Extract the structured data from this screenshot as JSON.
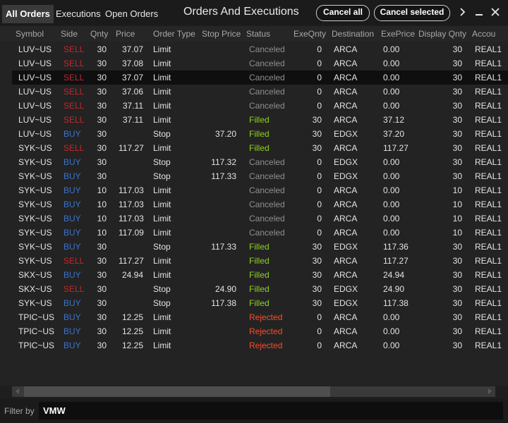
{
  "tabs": [
    {
      "label": "All Orders",
      "active": true
    },
    {
      "label": "Executions",
      "active": false
    },
    {
      "label": "Open Orders",
      "active": false
    }
  ],
  "window": {
    "title": "Orders And Executions"
  },
  "actions": {
    "cancel_all": "Cancel all",
    "cancel_selected": "Cancel selected"
  },
  "icons": {
    "more": "chevron-right-icon",
    "minimize": "minimize-icon",
    "close": "close-icon"
  },
  "colors": {
    "sell": "#c1272d",
    "buy": "#3b73c8",
    "filled": "#8ed21f",
    "rejected": "#ff4a2a",
    "canceled": "#8f8f8f"
  },
  "columns": [
    "Symbol",
    "Side",
    "Qnty",
    "Price",
    "Order Type",
    "Stop Price",
    "Status",
    "ExeQnty",
    "Destination",
    "ExePrice",
    "Display Qnty",
    "Accou"
  ],
  "selected_row": 2,
  "rows": [
    {
      "symbol": "LUV~US",
      "side": "SELL",
      "qty": "30",
      "price": "37.07",
      "type": "Limit",
      "stop": "",
      "status": "Canceled",
      "exe_qty": "0",
      "dest": "ARCA",
      "exe_price": "0.00",
      "display_qty": "30",
      "account": "REAL1"
    },
    {
      "symbol": "LUV~US",
      "side": "SELL",
      "qty": "30",
      "price": "37.08",
      "type": "Limit",
      "stop": "",
      "status": "Canceled",
      "exe_qty": "0",
      "dest": "ARCA",
      "exe_price": "0.00",
      "display_qty": "30",
      "account": "REAL1"
    },
    {
      "symbol": "LUV~US",
      "side": "SELL",
      "qty": "30",
      "price": "37.07",
      "type": "Limit",
      "stop": "",
      "status": "Canceled",
      "exe_qty": "0",
      "dest": "ARCA",
      "exe_price": "0.00",
      "display_qty": "30",
      "account": "REAL1"
    },
    {
      "symbol": "LUV~US",
      "side": "SELL",
      "qty": "30",
      "price": "37.06",
      "type": "Limit",
      "stop": "",
      "status": "Canceled",
      "exe_qty": "0",
      "dest": "ARCA",
      "exe_price": "0.00",
      "display_qty": "30",
      "account": "REAL1"
    },
    {
      "symbol": "LUV~US",
      "side": "SELL",
      "qty": "30",
      "price": "37.11",
      "type": "Limit",
      "stop": "",
      "status": "Canceled",
      "exe_qty": "0",
      "dest": "ARCA",
      "exe_price": "0.00",
      "display_qty": "30",
      "account": "REAL1"
    },
    {
      "symbol": "LUV~US",
      "side": "SELL",
      "qty": "30",
      "price": "37.11",
      "type": "Limit",
      "stop": "",
      "status": "Filled",
      "exe_qty": "30",
      "dest": "ARCA",
      "exe_price": "37.12",
      "display_qty": "30",
      "account": "REAL1"
    },
    {
      "symbol": "LUV~US",
      "side": "BUY",
      "qty": "30",
      "price": "",
      "type": "Stop",
      "stop": "37.20",
      "status": "Filled",
      "exe_qty": "30",
      "dest": "EDGX",
      "exe_price": "37.20",
      "display_qty": "30",
      "account": "REAL1"
    },
    {
      "symbol": "SYK~US",
      "side": "SELL",
      "qty": "30",
      "price": "117.27",
      "type": "Limit",
      "stop": "",
      "status": "Filled",
      "exe_qty": "30",
      "dest": "ARCA",
      "exe_price": "117.27",
      "display_qty": "30",
      "account": "REAL1"
    },
    {
      "symbol": "SYK~US",
      "side": "BUY",
      "qty": "30",
      "price": "",
      "type": "Stop",
      "stop": "117.32",
      "status": "Canceled",
      "exe_qty": "0",
      "dest": "EDGX",
      "exe_price": "0.00",
      "display_qty": "30",
      "account": "REAL1"
    },
    {
      "symbol": "SYK~US",
      "side": "BUY",
      "qty": "30",
      "price": "",
      "type": "Stop",
      "stop": "117.33",
      "status": "Canceled",
      "exe_qty": "0",
      "dest": "EDGX",
      "exe_price": "0.00",
      "display_qty": "30",
      "account": "REAL1"
    },
    {
      "symbol": "SYK~US",
      "side": "BUY",
      "qty": "10",
      "price": "117.03",
      "type": "Limit",
      "stop": "",
      "status": "Canceled",
      "exe_qty": "0",
      "dest": "ARCA",
      "exe_price": "0.00",
      "display_qty": "10",
      "account": "REAL1"
    },
    {
      "symbol": "SYK~US",
      "side": "BUY",
      "qty": "10",
      "price": "117.03",
      "type": "Limit",
      "stop": "",
      "status": "Canceled",
      "exe_qty": "0",
      "dest": "ARCA",
      "exe_price": "0.00",
      "display_qty": "10",
      "account": "REAL1"
    },
    {
      "symbol": "SYK~US",
      "side": "BUY",
      "qty": "10",
      "price": "117.03",
      "type": "Limit",
      "stop": "",
      "status": "Canceled",
      "exe_qty": "0",
      "dest": "ARCA",
      "exe_price": "0.00",
      "display_qty": "10",
      "account": "REAL1"
    },
    {
      "symbol": "SYK~US",
      "side": "BUY",
      "qty": "10",
      "price": "117.09",
      "type": "Limit",
      "stop": "",
      "status": "Canceled",
      "exe_qty": "0",
      "dest": "ARCA",
      "exe_price": "0.00",
      "display_qty": "10",
      "account": "REAL1"
    },
    {
      "symbol": "SYK~US",
      "side": "BUY",
      "qty": "30",
      "price": "",
      "type": "Stop",
      "stop": "117.33",
      "status": "Filled",
      "exe_qty": "30",
      "dest": "EDGX",
      "exe_price": "117.36",
      "display_qty": "30",
      "account": "REAL1"
    },
    {
      "symbol": "SYK~US",
      "side": "SELL",
      "qty": "30",
      "price": "117.27",
      "type": "Limit",
      "stop": "",
      "status": "Filled",
      "exe_qty": "30",
      "dest": "ARCA",
      "exe_price": "117.27",
      "display_qty": "30",
      "account": "REAL1"
    },
    {
      "symbol": "SKX~US",
      "side": "BUY",
      "qty": "30",
      "price": "24.94",
      "type": "Limit",
      "stop": "",
      "status": "Filled",
      "exe_qty": "30",
      "dest": "ARCA",
      "exe_price": "24.94",
      "display_qty": "30",
      "account": "REAL1"
    },
    {
      "symbol": "SKX~US",
      "side": "SELL",
      "qty": "30",
      "price": "",
      "type": "Stop",
      "stop": "24.90",
      "status": "Filled",
      "exe_qty": "30",
      "dest": "EDGX",
      "exe_price": "24.90",
      "display_qty": "30",
      "account": "REAL1"
    },
    {
      "symbol": "SYK~US",
      "side": "BUY",
      "qty": "30",
      "price": "",
      "type": "Stop",
      "stop": "117.38",
      "status": "Filled",
      "exe_qty": "30",
      "dest": "EDGX",
      "exe_price": "117.38",
      "display_qty": "30",
      "account": "REAL1"
    },
    {
      "symbol": "TPIC~US",
      "side": "BUY",
      "qty": "30",
      "price": "12.25",
      "type": "Limit",
      "stop": "",
      "status": "Rejected",
      "exe_qty": "0",
      "dest": "ARCA",
      "exe_price": "0.00",
      "display_qty": "30",
      "account": "REAL1"
    },
    {
      "symbol": "TPIC~US",
      "side": "BUY",
      "qty": "30",
      "price": "12.25",
      "type": "Limit",
      "stop": "",
      "status": "Rejected",
      "exe_qty": "0",
      "dest": "ARCA",
      "exe_price": "0.00",
      "display_qty": "30",
      "account": "REAL1"
    },
    {
      "symbol": "TPIC~US",
      "side": "BUY",
      "qty": "30",
      "price": "12.25",
      "type": "Limit",
      "stop": "",
      "status": "Rejected",
      "exe_qty": "0",
      "dest": "ARCA",
      "exe_price": "0.00",
      "display_qty": "30",
      "account": "REAL1"
    }
  ],
  "filter": {
    "label": "Filter by",
    "value": "VMW"
  }
}
